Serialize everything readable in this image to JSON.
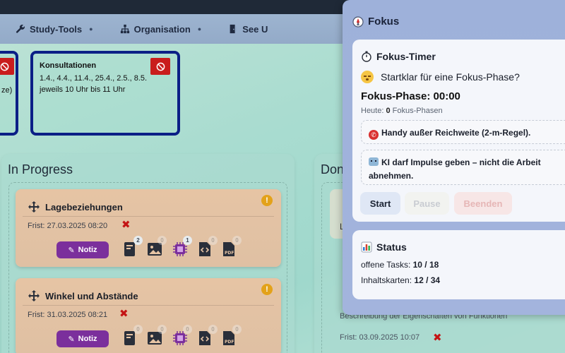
{
  "nav": {
    "items": [
      {
        "label": "Study-Tools",
        "icon": "wrench-icon",
        "has_dropdown": true
      },
      {
        "label": "Organisation",
        "icon": "sitemap-icon",
        "has_dropdown": true
      },
      {
        "label": "See U",
        "icon": "door-exit-icon",
        "has_dropdown": false
      }
    ]
  },
  "top_cards": {
    "left_partial": {
      "text": "ze)"
    },
    "consultation": {
      "title": "Konsultationen",
      "dates": "1.4., 4.4., 11.4., 25.4., 2.5., 8.5.",
      "time": "jeweils 10 Uhr bis 11 Uhr"
    }
  },
  "columns": {
    "in_progress": {
      "title": "In Progress",
      "tasks": [
        {
          "title": "Lagebeziehungen",
          "deadline": "Frist: 27.03.2025 08:20",
          "note_label": "Notiz",
          "warning": "!",
          "counts": {
            "book": "2",
            "image": "0",
            "chip": "1",
            "code": "0",
            "pdf": "0"
          }
        },
        {
          "title": "Winkel und Abstände",
          "deadline": "Frist: 31.03.2025 08:21",
          "note_label": "Notiz",
          "warning": "!",
          "counts": {
            "book": "0",
            "image": "0",
            "chip": "0",
            "code": "0",
            "pdf": "0"
          }
        }
      ]
    },
    "done": {
      "title": "Don",
      "card_letter": "L",
      "description": "Beschreibung der Eigenschaften von Funktionen",
      "deadline": "Frist: 03.09.2025 10:07"
    }
  },
  "focus_panel": {
    "title": "Fokus",
    "timer": {
      "title": "Fokus-Timer",
      "ready_text": "Startklar für eine Fokus-Phase?",
      "phase_text": "Fokus-Phase: 00:00",
      "today_prefix": "Heute:",
      "today_count": "0",
      "today_suffix": "Fokus-Phasen",
      "tip1": "Handy außer Reichweite (2-m-Regel).",
      "tip2": "KI darf Impulse geben – nicht die Arbeit abnehmen.",
      "buttons": {
        "start": "Start",
        "pause": "Pause",
        "end": "Beenden"
      }
    },
    "status": {
      "title": "Status",
      "open_label": "offene Tasks:",
      "open_value": "10 / 18",
      "cards_label": "Inhaltskarten:",
      "cards_value": "12 / 34"
    }
  },
  "colors": {
    "accent_purple": "#7b2f9c",
    "danger_red": "#c41414",
    "card_border_navy": "#0b1f86",
    "warning_orange": "#e3a21a"
  }
}
